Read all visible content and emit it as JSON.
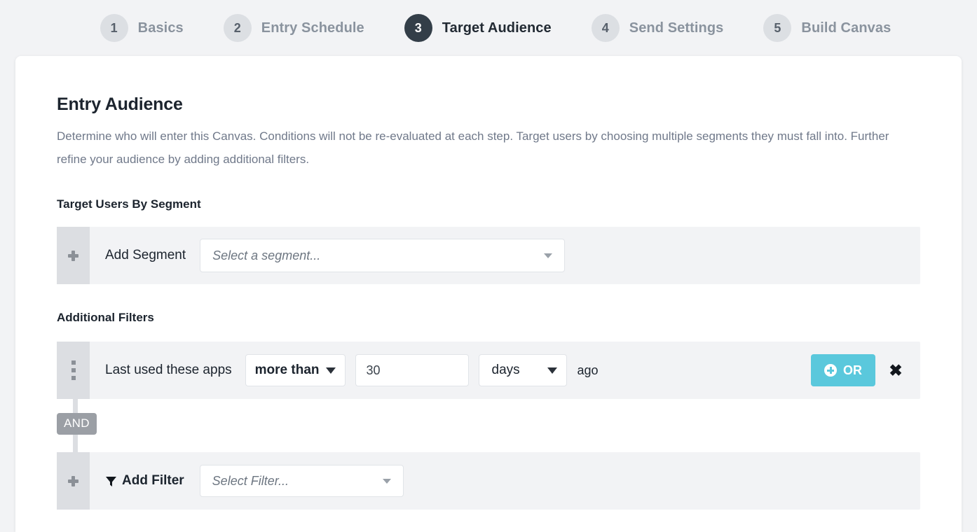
{
  "stepper": {
    "steps": [
      {
        "number": "1",
        "label": "Basics",
        "active": false
      },
      {
        "number": "2",
        "label": "Entry Schedule",
        "active": false
      },
      {
        "number": "3",
        "label": "Target Audience",
        "active": true
      },
      {
        "number": "4",
        "label": "Send Settings",
        "active": false
      },
      {
        "number": "5",
        "label": "Build Canvas",
        "active": false
      }
    ]
  },
  "page": {
    "title": "Entry Audience",
    "description": "Determine who will enter this Canvas. Conditions will not be re-evaluated at each step. Target users by choosing multiple segments they must fall into. Further refine your audience by adding additional filters."
  },
  "segment_section": {
    "heading": "Target Users By Segment",
    "add_label": "Add Segment",
    "select_placeholder": "Select a segment...",
    "select_value": "",
    "add_icon": "plus-icon",
    "caret_icon": "chevron-down-icon"
  },
  "filters_section": {
    "heading": "Additional Filters",
    "filter_row": {
      "drag_handle_icon": "drag-dots-icon",
      "label": "Last used these apps",
      "operator": "more than",
      "value": "30",
      "unit": "days",
      "suffix": "ago",
      "or_label": "OR",
      "or_icon": "plus-circle-icon",
      "remove_icon": "close-icon",
      "remove_label": "✖"
    },
    "connector": {
      "label": "AND"
    },
    "add_filter_row": {
      "add_icon": "plus-icon",
      "filter_icon": "funnel-icon",
      "label": "Add Filter",
      "select_placeholder": "Select Filter...",
      "select_value": "",
      "caret_icon": "chevron-down-icon"
    }
  },
  "colors": {
    "page_background": "#f2f3f5",
    "card_background": "#ffffff",
    "active_step": "#333e48",
    "inactive_step": "#dcdfe3",
    "row_background": "#f2f3f5",
    "handle_background": "#dcdee2",
    "or_button": "#5ac8dc",
    "and_badge": "#9b9fa5",
    "heading_text": "#1c242e",
    "muted_text": "#70798a"
  }
}
